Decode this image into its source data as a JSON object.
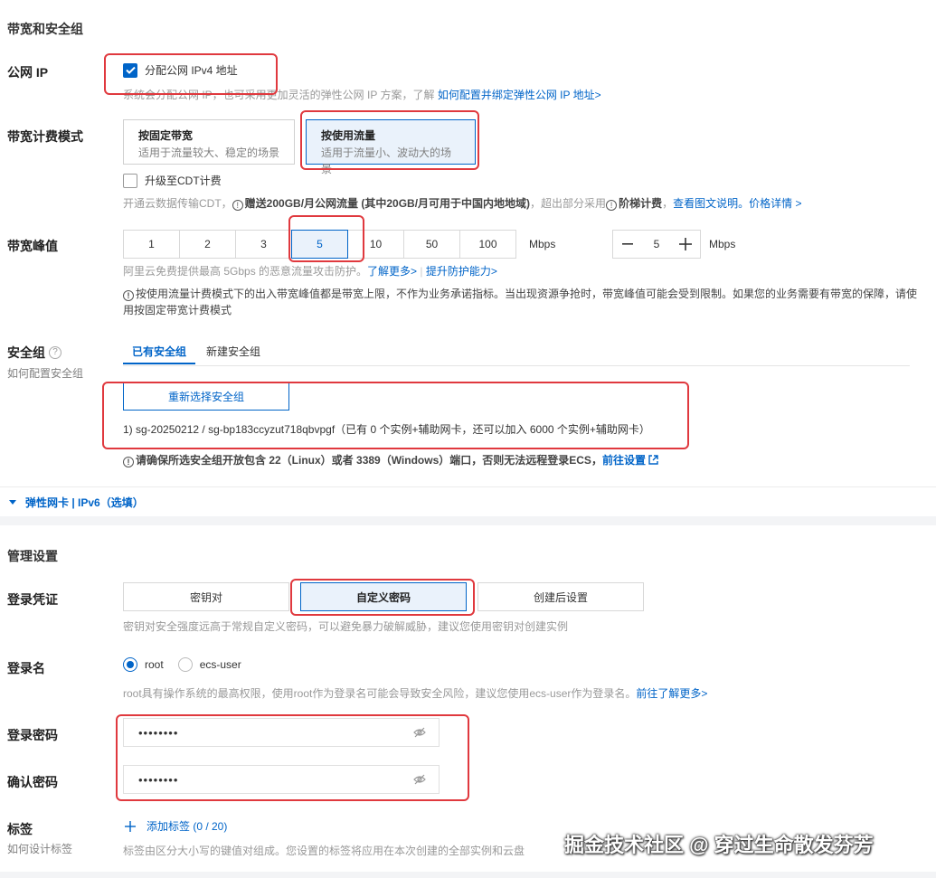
{
  "bandwidth_section": {
    "title": "带宽和安全组",
    "public_ip": {
      "label": "公网 IP",
      "checkbox_label": "分配公网 IPv4 地址",
      "checked": true,
      "hint": "系统会分配公网 IP，也可采用更加灵活的弹性公网 IP 方案，了解",
      "hint_link": "如何配置并绑定弹性公网 IP 地址>"
    },
    "billing_mode": {
      "label": "带宽计费模式",
      "options": [
        {
          "title": "按固定带宽",
          "desc": "适用于流量较大、稳定的场景"
        },
        {
          "title": "按使用流量",
          "desc": "适用于流量小、波动大的场景"
        }
      ],
      "selected_index": 1,
      "cdt_checkbox_label": "升级至CDT计费",
      "cdt_hint_prefix": "开通云数据传输CDT，",
      "cdt_hint_bold": "赠送200GB/月公网流量 (其中20GB/月可用于中国内地地域)",
      "cdt_hint_mid": "，超出部分采用",
      "cdt_hint_bold2": "阶梯计费",
      "cdt_hint_suffix": "，",
      "cdt_link1": "查看图文说明。",
      "cdt_link2": "价格详情 >"
    },
    "peak_bandwidth": {
      "label": "带宽峰值",
      "options": [
        "1",
        "2",
        "3",
        "5",
        "10",
        "50",
        "100"
      ],
      "selected": "5",
      "unit": "Mbps",
      "stepper_value": "5",
      "stepper_unit": "Mbps",
      "hint": "阿里云免费提供最高 5Gbps 的恶意流量攻击防护。",
      "hint_link1": "了解更多>",
      "hint_link2": "提升防护能力>",
      "note": "按使用流量计费模式下的出入带宽峰值都是带宽上限，不作为业务承诺指标。当出现资源争抢时，带宽峰值可能会受到限制。如果您的业务需要有带宽的保障，请使用按固定带宽计费模式"
    },
    "security_group": {
      "label": "安全组",
      "sublabel": "如何配置安全组",
      "tabs": [
        "已有安全组",
        "新建安全组"
      ],
      "active_tab": 0,
      "reselect_button": "重新选择安全组",
      "selected_item": "1) sg-20250212 / sg-bp183ccyzut718qbvpgf（已有 0 个实例+辅助网卡，还可以加入 6000 个实例+辅助网卡）",
      "port_note": "请确保所选安全组开放包含 22（Linux）或者 3389（Windows）端口，否则无法远程登录ECS，",
      "port_link": "前往设置"
    },
    "eni_toggle": "弹性网卡 | IPv6（选填）"
  },
  "management_section": {
    "title": "管理设置",
    "credential": {
      "label": "登录凭证",
      "options": [
        "密钥对",
        "自定义密码",
        "创建后设置"
      ],
      "selected_index": 1,
      "hint": "密钥对安全强度远高于常规自定义密码，可以避免暴力破解威胁，建议您使用密钥对创建实例"
    },
    "login_name": {
      "label": "登录名",
      "options": [
        "root",
        "ecs-user"
      ],
      "selected": "root",
      "hint": "root具有操作系统的最高权限，使用root作为登录名可能会导致安全风险，建议您使用ecs-user作为登录名。",
      "hint_link": "前往了解更多>"
    },
    "login_password": {
      "label": "登录密码",
      "value": "••••••••"
    },
    "confirm_password": {
      "label": "确认密码",
      "value": "••••••••"
    },
    "tags": {
      "label": "标签",
      "sublabel": "如何设计标签",
      "add_button": "添加标签 (0 / 20)",
      "hint": "标签由区分大小写的键值对组成。您设置的标签将应用在本次创建的全部实例和云盘"
    }
  },
  "watermark": "掘金技术社区 @ 穿过生命散发芬芳",
  "colors": {
    "accent": "#0064c8",
    "highlight": "#e0393e"
  }
}
